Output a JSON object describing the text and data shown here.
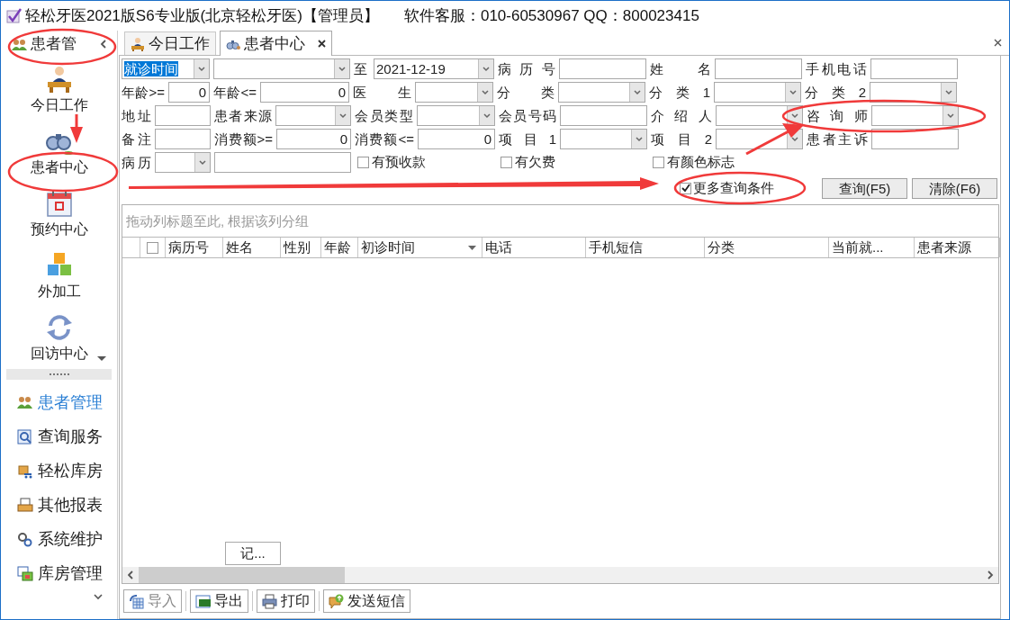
{
  "window": {
    "title": "轻松牙医2021版S6专业版(北京轻松牙医)【管理员】",
    "support": "软件客服：010-60530967 QQ：800023415"
  },
  "sidebar": {
    "header": "患者管",
    "items": [
      {
        "label": "今日工作"
      },
      {
        "label": "患者中心"
      },
      {
        "label": "预约中心"
      },
      {
        "label": "外加工"
      },
      {
        "label": "回访中心"
      }
    ],
    "groups": [
      {
        "label": "患者管理",
        "selected": true
      },
      {
        "label": "查询服务",
        "selected": false
      },
      {
        "label": "轻松库房",
        "selected": false
      },
      {
        "label": "其他报表",
        "selected": false
      },
      {
        "label": "系统维护",
        "selected": false
      },
      {
        "label": "库房管理",
        "selected": false
      }
    ]
  },
  "tabs": [
    {
      "label": "今日工作",
      "selected": false,
      "closable": false
    },
    {
      "label": "患者中心",
      "selected": true,
      "closable": true
    }
  ],
  "filters": [
    [
      {
        "kind": "combo",
        "value": "就诊时间",
        "focused": true
      },
      {
        "kind": "combo"
      },
      {
        "kind": "label",
        "text": "至"
      },
      {
        "kind": "combo",
        "value": "2021-12-19"
      },
      {
        "kind": "label",
        "text": "病 历 号"
      },
      {
        "kind": "input"
      },
      {
        "kind": "label",
        "text": "姓 名"
      },
      {
        "kind": "input"
      },
      {
        "kind": "label",
        "text": "手机电话"
      },
      {
        "kind": "input"
      }
    ],
    [
      {
        "kind": "label",
        "text": "年龄>="
      },
      {
        "kind": "number",
        "value": "0"
      },
      {
        "kind": "label",
        "text": "年龄<="
      },
      {
        "kind": "number",
        "value": "0"
      },
      {
        "kind": "label",
        "text": "医 生"
      },
      {
        "kind": "combo"
      },
      {
        "kind": "label",
        "text": "分 类"
      },
      {
        "kind": "combo"
      },
      {
        "kind": "label",
        "text": "分类1"
      },
      {
        "kind": "combo"
      },
      {
        "kind": "label",
        "text": "分类2"
      },
      {
        "kind": "combo"
      }
    ],
    [
      {
        "kind": "label",
        "text": "地址"
      },
      {
        "kind": "input"
      },
      {
        "kind": "label",
        "text": "患者来源"
      },
      {
        "kind": "combo"
      },
      {
        "kind": "label",
        "text": "会员类型"
      },
      {
        "kind": "combo"
      },
      {
        "kind": "label",
        "text": "会员号码"
      },
      {
        "kind": "input"
      },
      {
        "kind": "label",
        "text": "介 绍 人"
      },
      {
        "kind": "combo"
      },
      {
        "kind": "label",
        "text": "咨 询 师"
      },
      {
        "kind": "combo"
      }
    ],
    [
      {
        "kind": "label",
        "text": "备注"
      },
      {
        "kind": "input"
      },
      {
        "kind": "label",
        "text": "消费额>="
      },
      {
        "kind": "number",
        "value": "0"
      },
      {
        "kind": "label",
        "text": "消费额<="
      },
      {
        "kind": "number",
        "value": "0"
      },
      {
        "kind": "label",
        "text": "项目1"
      },
      {
        "kind": "combo"
      },
      {
        "kind": "label",
        "text": "项目2"
      },
      {
        "kind": "combo"
      },
      {
        "kind": "label",
        "text": "患者主诉"
      },
      {
        "kind": "input"
      }
    ],
    [
      {
        "kind": "label",
        "text": "病历"
      },
      {
        "kind": "combo"
      },
      {
        "kind": "input"
      },
      {
        "kind": "check",
        "label": "有预收款",
        "checked": false
      },
      {
        "kind": "check",
        "label": "有欠费",
        "checked": false
      },
      {
        "kind": "check",
        "label": "有颜色标志",
        "checked": false
      }
    ]
  ],
  "more_conditions": {
    "label": "更多查询条件",
    "checked": true
  },
  "buttons": [
    "查询(F5)",
    "清除(F6)"
  ],
  "table": {
    "group_hint": "拖动列标题至此, 根据该列分组",
    "select_all": false,
    "columns": [
      {
        "label": "病历号",
        "sorted": false
      },
      {
        "label": "姓名",
        "sorted": false
      },
      {
        "label": "性别",
        "sorted": false
      },
      {
        "label": "年龄",
        "sorted": false
      },
      {
        "label": "初诊时间",
        "sorted": true
      },
      {
        "label": "电话",
        "sorted": false
      },
      {
        "label": "手机短信",
        "sorted": false
      },
      {
        "label": "分类",
        "sorted": false
      },
      {
        "label": "当前就...",
        "sorted": false
      },
      {
        "label": "患者来源",
        "sorted": false
      }
    ],
    "footer_button": "记..."
  },
  "toolbar": [
    {
      "label": "导入",
      "disabled": true
    },
    {
      "label": "导出",
      "disabled": false
    },
    {
      "label": "打印",
      "disabled": false
    },
    {
      "label": "发送短信",
      "disabled": false
    }
  ]
}
